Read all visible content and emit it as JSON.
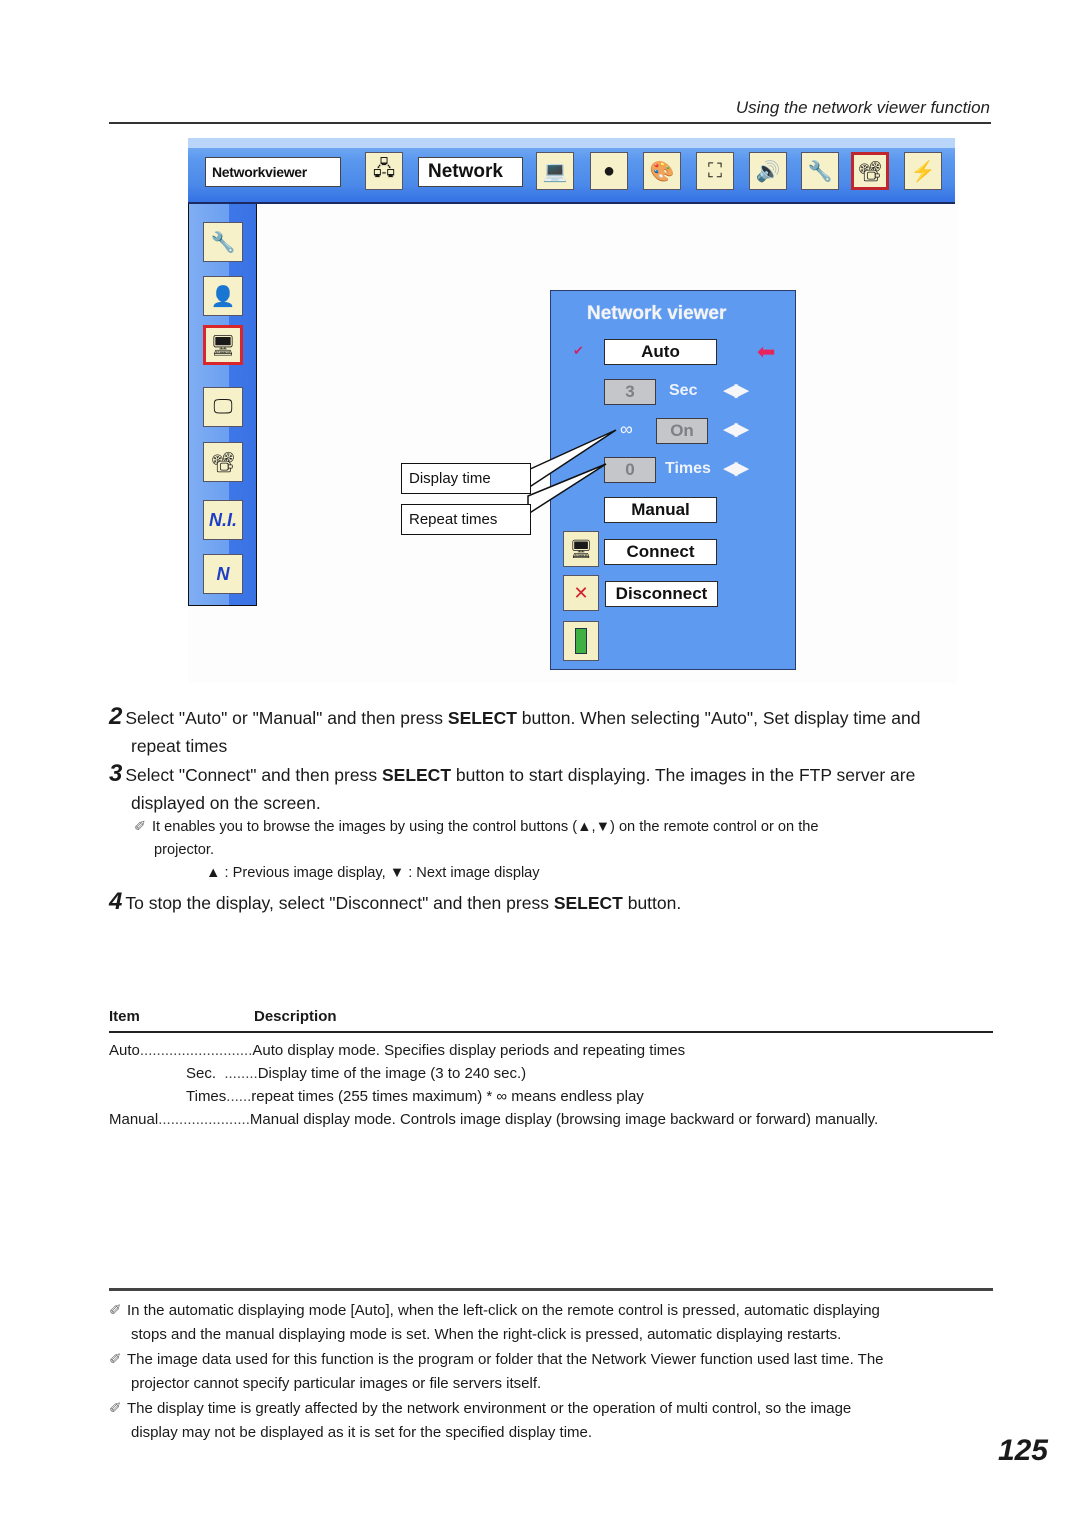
{
  "header": {
    "title": "Using the network viewer function"
  },
  "osd": {
    "topbar": {
      "section_label": "Networkviewer",
      "menu_label": "Network",
      "icons": [
        "network-viewer-icon",
        "network-icon",
        "pc-icon",
        "color-icon",
        "image-adjust-icon",
        "screen-icon",
        "sound-icon",
        "setting-icon",
        "network-projector-icon",
        "power-icon"
      ],
      "selected_icon": "network-projector-icon"
    },
    "sidebar": {
      "icons": [
        "tools-icon",
        "user-icon",
        "network-viewer-icon",
        "multi-display-icon",
        "projector-network-icon",
        "network-info-icon",
        "network-factory-icon"
      ],
      "selected_icon": "network-viewer-icon",
      "ni_label": "N.I.",
      "n_label": "N"
    },
    "panel": {
      "title": "Network viewer",
      "check": "✔",
      "auto_label": "Auto",
      "sec_value": "3",
      "sec_unit": "Sec",
      "infinity_symbol": "∞",
      "on_value": "On",
      "times_value": "0",
      "times_unit": "Times",
      "manual_label": "Manual",
      "connect_label": "Connect",
      "disconnect_label": "Disconnect",
      "arrow_lr": "◀▶",
      "pointer_arrow": "⬅"
    },
    "callouts": {
      "display_time": "Display time",
      "repeat_times": "Repeat times"
    }
  },
  "steps": [
    {
      "num": "2",
      "pre": "Select \"Auto\" or \"Manual\" and then press ",
      "bold": "SELECT",
      "post": " button. When selecting \"Auto\", Set display time and",
      "cont": "repeat times"
    },
    {
      "num": "3",
      "pre": "Select \"Connect\" and then press ",
      "bold": "SELECT",
      "post": " button to start displaying. The images in the FTP server are",
      "cont": "displayed on the  screen."
    },
    {
      "num": "4",
      "pre": "To stop the display, select \"Disconnect\" and then press ",
      "bold": "SELECT",
      "post": " button."
    }
  ],
  "browse_note": {
    "line1": "It enables you to browse the images by using the control buttons (▲,▼) on the remote control or on the",
    "line2": "projector.",
    "line3": "▲ : Previous image display,  ▼ : Next image display"
  },
  "table": {
    "headers": {
      "item": "Item",
      "description": "Description"
    },
    "rows": [
      {
        "item": "Auto",
        "dots": "...........................",
        "desc": "Auto display mode. Specifies display periods and repeating times"
      },
      {
        "item": "Sec.",
        "dots": "  ........",
        "desc": "Display time of the image (3 to 240 sec.)"
      },
      {
        "item": "Times",
        "dots": "......",
        "desc": "repeat times (255 times maximum) * ∞ means endless play"
      },
      {
        "item": "Manual",
        "dots": "......................",
        "desc": "Manual display mode. Controls image display (browsing image backward or forward) manually."
      }
    ]
  },
  "footnotes": [
    {
      "l1": "In the automatic displaying mode [Auto], when the left-click on the remote control is pressed, automatic displaying",
      "l2": "stops and the manual displaying mode is set. When the right-click is pressed, automatic displaying restarts."
    },
    {
      "l1": "The image data used for this function is the program or folder that the Network Viewer function used last time. The",
      "l2": "projector cannot specify particular images or file servers itself."
    },
    {
      "l1": "The display time is greatly affected by the network environment or the operation of multi control, so the image",
      "l2": "display may not be displayed as it is set for the specified display time."
    }
  ],
  "pencil_icon": "✐",
  "page_number": "125"
}
